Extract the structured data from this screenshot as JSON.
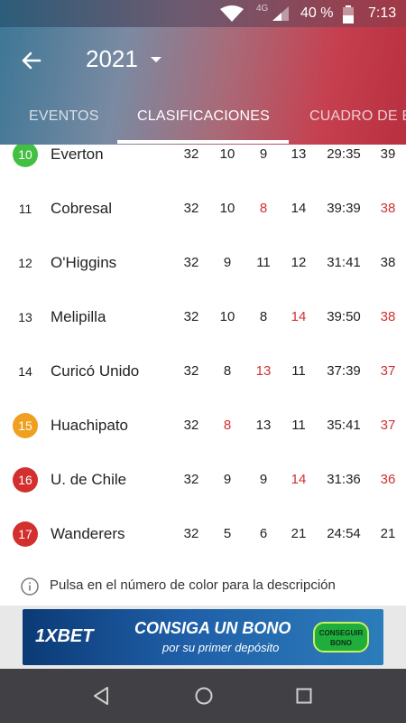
{
  "status_bar": {
    "network": "4G",
    "battery": "40 %",
    "time": "7:13"
  },
  "app_bar": {
    "year": "2021",
    "back_icon": "arrow-left-icon",
    "dropdown_icon": "caret-down-icon"
  },
  "tabs": [
    {
      "label": "EVENTOS",
      "active": false
    },
    {
      "label": "CLASIFICACIONES",
      "active": true
    },
    {
      "label": "CUADRO DE E",
      "active": false
    }
  ],
  "standings": [
    {
      "pos": "10",
      "badge_color": "#43c043",
      "team": "Everton",
      "pj": "32",
      "pg": "10",
      "pe": "9",
      "pp": "13",
      "goals": "29:35",
      "pts": "39",
      "red": []
    },
    {
      "pos": "11",
      "badge_color": "",
      "team": "Cobresal",
      "pj": "32",
      "pg": "10",
      "pe": "8",
      "pp": "14",
      "goals": "39:39",
      "pts": "38",
      "red": [
        "pe",
        "pts"
      ]
    },
    {
      "pos": "12",
      "badge_color": "",
      "team": "O'Higgins",
      "pj": "32",
      "pg": "9",
      "pe": "11",
      "pp": "12",
      "goals": "31:41",
      "pts": "38",
      "red": []
    },
    {
      "pos": "13",
      "badge_color": "",
      "team": "Melipilla",
      "pj": "32",
      "pg": "10",
      "pe": "8",
      "pp": "14",
      "goals": "39:50",
      "pts": "38",
      "red": [
        "pp",
        "pts"
      ]
    },
    {
      "pos": "14",
      "badge_color": "",
      "team": "Curicó Unido",
      "pj": "32",
      "pg": "8",
      "pe": "13",
      "pp": "11",
      "goals": "37:39",
      "pts": "37",
      "red": [
        "pe",
        "pts"
      ]
    },
    {
      "pos": "15",
      "badge_color": "#f0a020",
      "team": "Huachipato",
      "pj": "32",
      "pg": "8",
      "pe": "13",
      "pp": "11",
      "goals": "35:41",
      "pts": "37",
      "red": [
        "pg",
        "pts"
      ]
    },
    {
      "pos": "16",
      "badge_color": "#d32f2f",
      "team": "U. de Chile",
      "pj": "32",
      "pg": "9",
      "pe": "9",
      "pp": "14",
      "goals": "31:36",
      "pts": "36",
      "red": [
        "pp",
        "pts"
      ]
    },
    {
      "pos": "17",
      "badge_color": "#d32f2f",
      "team": "Wanderers",
      "pj": "32",
      "pg": "5",
      "pe": "6",
      "pp": "21",
      "goals": "24:54",
      "pts": "21",
      "red": []
    }
  ],
  "hint": {
    "icon": "info-icon",
    "text": "Pulsa en el número de color para la descripción"
  },
  "ad": {
    "brand": "1XBET",
    "title": "CONSIGA UN BONO",
    "subtitle": "por su primer depósito",
    "button": "CONSEGUIR BONO"
  },
  "nav": {
    "back_icon": "nav-back-icon",
    "home_icon": "nav-home-icon",
    "recent_icon": "nav-recent-icon"
  },
  "colors": {
    "accent_red": "#d32f2f",
    "header_gradient_start": "#3e7796",
    "header_gradient_end": "#c63f4f"
  }
}
